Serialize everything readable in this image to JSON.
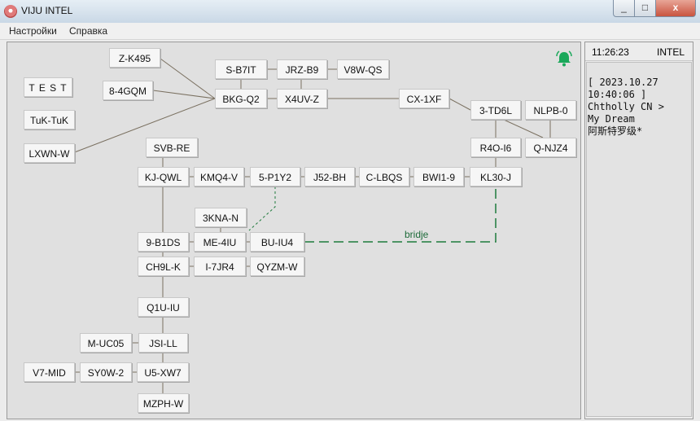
{
  "window": {
    "title": "VIJU INTEL",
    "min_glyph": "_",
    "max_glyph": "□",
    "close_glyph": "x"
  },
  "menu": {
    "items": [
      "Настройки",
      "Справка"
    ]
  },
  "map": {
    "nodes": {
      "test": "T E S T",
      "tuktuk": "TuK-TuK",
      "lxwn": "LXWN-W",
      "z_k495": "Z-K495",
      "8_4gqm": "8-4GQM",
      "s_b7it": "S-B7IT",
      "jrz_b9": "JRZ-B9",
      "v8w_qs": "V8W-QS",
      "bkg_q2": "BKG-Q2",
      "x4uv_z": "X4UV-Z",
      "cx_1xf": "CX-1XF",
      "3_td6l": "3-TD6L",
      "nlpb_0": "NLPB-0",
      "r4o_i6": "R4O-I6",
      "q_njz4": "Q-NJZ4",
      "svb_re": "SVB-RE",
      "kj_qwl": "KJ-QWL",
      "kmq4_v": "KMQ4-V",
      "5_p1y2": "5-P1Y2",
      "j52_bh": "J52-BH",
      "c_lbqs": "C-LBQS",
      "bwi1_9": "BWI1-9",
      "kl30_j": "KL30-J",
      "3kna_n": "3KNA-N",
      "9_b1ds": "9-B1DS",
      "me_4iu": "ME-4IU",
      "bu_iu4": "BU-IU4",
      "ch9l_k": "CH9L-K",
      "i_7jr4": "I-7JR4",
      "qyzm_w": "QYZM-W",
      "q1u_iu": "Q1U-IU",
      "m_uc05": "M-UC05",
      "jsi_ll": "JSI-LL",
      "v7_mid": "V7-MID",
      "sy0w_2": "SY0W-2",
      "u5_xw7": "U5-XW7",
      "mzph_w": "MZPH-W"
    },
    "bridge_label": "bridje",
    "colors": {
      "link": "#7a7060",
      "bridge": "#1e7a3c",
      "bell": "#1aa85a"
    }
  },
  "side": {
    "time": "11:26:23",
    "region": "INTEL",
    "log": [
      "[ 2023.10.27",
      "10:40:06 ]",
      "Chtholly CN >",
      "My Dream",
      "阿斯特罗级*"
    ]
  }
}
